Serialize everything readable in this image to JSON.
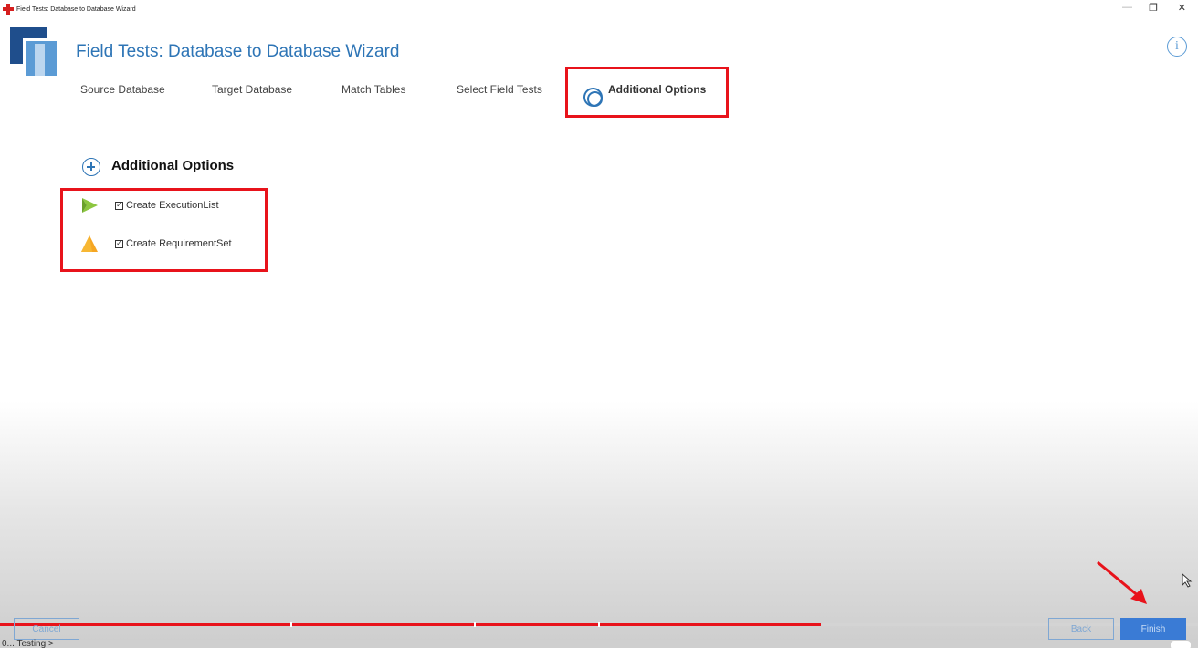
{
  "window": {
    "title": "Field Tests: Database to Database Wizard",
    "controls": {
      "minimize": "—",
      "restore": "❐",
      "close": "✕"
    }
  },
  "header": {
    "title": "Field Tests: Database to Database Wizard",
    "info_symbol": "i"
  },
  "steps": [
    {
      "label": "Source Database",
      "state": "done"
    },
    {
      "label": "Target Database",
      "state": "done"
    },
    {
      "label": "Match Tables",
      "state": "done"
    },
    {
      "label": "Select Field Tests",
      "state": "done"
    },
    {
      "label": "Additional Options",
      "state": "current"
    }
  ],
  "section": {
    "title": "Additional Options",
    "options": [
      {
        "label": "Create ExecutionList",
        "checked": true,
        "icon": "execution-list-icon",
        "color": "#8cc63f"
      },
      {
        "label": "Create RequirementSet",
        "checked": true,
        "icon": "requirement-set-icon",
        "color": "#f5a623"
      }
    ]
  },
  "buttons": {
    "cancel": "Cancel",
    "back": "Back",
    "finish": "Finish"
  },
  "wizard_progress": 0.685,
  "bottom_strip_text": "0... Testing >",
  "colors": {
    "accent": "#2e75b6",
    "highlight": "#e8131b",
    "finish_button": "#3a7bd5"
  }
}
